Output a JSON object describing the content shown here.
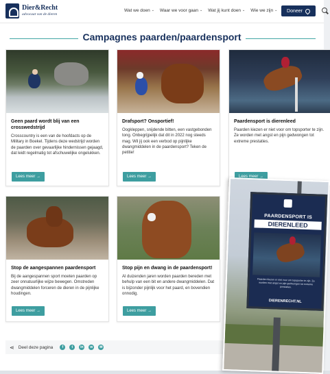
{
  "header": {
    "logo_name": "Dier&Recht",
    "logo_tagline": "advocaat van de dieren",
    "nav": [
      "Wat we doen",
      "Waar we voor gaan",
      "Wat jij kunt doen",
      "Wie we zijn"
    ],
    "donate_label": "Doneer",
    "colors": {
      "brand": "#17305c",
      "accent": "#3e9ea0"
    }
  },
  "page_title": "Campagnes paarden/paardensport",
  "cards": [
    {
      "title": "Geen paard wordt blij van een crosswedstrijd",
      "text": "Crosscountry is een van de hoofdacts op de Military in Boekel. Tijdens deze wedstrijd worden de paarden over gevaarlijke hindernissen gejaagd, dat leidt regelmatig tot afschuwelijke ongelukken.",
      "button": "Lees meer →"
    },
    {
      "title": "Draf​sport? Onsportief!",
      "text": "Oogkleppen, snijdende bitten, een vastgebonden tong. Onbegrijpelijk dat dit in 2022 nog steeds mag. Wil jij ook een verbod op pijnlijke dwangmiddelen in de paardensport? Teken de petitie!",
      "button": "Lees meer →"
    },
    {
      "title": "Paardensport is dierenleed",
      "text": "Paarden kiezen er niet voor om topsporter te zijn. Ze worden met angst en pijn gedwongen tot extreme prestaties.",
      "button": "Lees meer →"
    },
    {
      "title": "Stop de aangespannen paardensport",
      "text": "Bij de aangespannen sport moeten paarden op zeer onnatuurlijke wijze bewegen. Omstreden dwangmiddelen forceren de dieren in de pijnlijke houdingen.",
      "button": "Lees meer →"
    },
    {
      "title": "Stop pijn en dwang in de paardensport!",
      "text": "Al duizenden jaren worden paarden bereden met behulp van een bit en andere dwangmiddelen. Dat is bijzonder pijnlijk voor het paard, en bovendien onnodig.",
      "button": "Lees meer →"
    }
  ],
  "share": {
    "label": "Deel deze pagina",
    "icons": [
      "facebook-icon",
      "twitter-icon",
      "linkedin-icon",
      "whatsapp-icon",
      "email-icon"
    ]
  },
  "poster": {
    "line1": "PAARDENSPORT IS",
    "line2": "DIERENLEED",
    "body": "Paarden kiezen er niet voor om topsporter te zijn. Ze worden met angst en pijn gedwongen tot extreme prestaties.",
    "url": "DIERENRECHT.NL"
  }
}
